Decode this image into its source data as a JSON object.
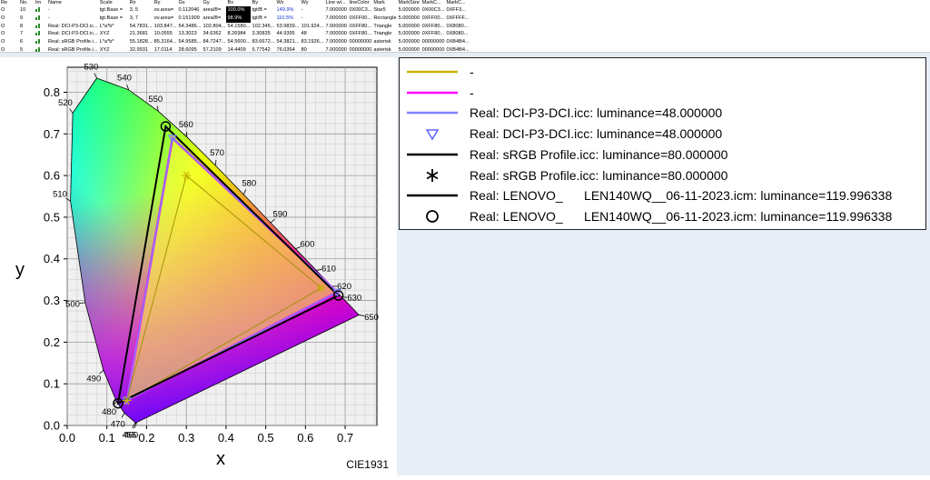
{
  "table": {
    "headers": [
      "Re",
      "No.",
      "Im",
      "Name",
      "Scale",
      "Rx",
      "Ry",
      "Gx",
      "Gy",
      "Bx",
      "By",
      "Wx",
      "Wy",
      "Line wi...",
      "lineColor",
      "Mark",
      "MarkSize",
      "MarkC...",
      "MarkC..."
    ],
    "rows": [
      [
        "O",
        "10",
        "",
        "-",
        "tgt.Base =",
        "3, 5",
        "ov.area=",
        "0.112046",
        "area/B=",
        "100.0%",
        "tgt/B =",
        "149.9%",
        "-",
        "7.000000",
        "0X00C3...",
        "Star5",
        "5.000000",
        "0X00C3...",
        "0XFF3..."
      ],
      [
        "O",
        "9",
        "",
        "-",
        "tgt.Base =",
        "3, 7",
        "ov.area=",
        "0.151909",
        "area/B=",
        "98.9%",
        "tgt/B =",
        "110.5%",
        "-",
        "7.000000",
        "0XFF00...",
        "Rectangle",
        "5.000000",
        "0XFF00...",
        "0XFFFF..."
      ],
      [
        "O",
        "8",
        "",
        "Real: DCI-P3-DCI.ic...",
        "L*a*b*",
        "54.7831...",
        "103.847...",
        "54.3486...",
        "102.804...",
        "54.1580...",
        "102.345...",
        "53.9839...",
        "101.924...",
        "7.000000",
        "0XFF80...",
        "Triangle",
        "5.000000",
        "0XFF80...",
        "0X8080..."
      ],
      [
        "O",
        "7",
        "",
        "Real: DCI-P3-DCI.ic...",
        "XYZ",
        "21.3681",
        "10.0555",
        "13.3023",
        "34.6362",
        "8.26984",
        "3.30835",
        "44.9395",
        "48",
        "7.000000",
        "0XFF80...",
        "Triangle",
        "5.000000",
        "0XFF80...",
        "0X8080..."
      ],
      [
        "O",
        "6",
        "",
        "Real: sRGB Profile.i...",
        "L*a*b*",
        "55.1828...",
        "85.3164...",
        "54.9585...",
        "84.7247...",
        "54.5600...",
        "83.6672...",
        "54.3821...",
        "83.1926...",
        "7.000000",
        "00000000",
        "asterisk",
        "5.000000",
        "00000000",
        "0XB4B4..."
      ],
      [
        "O",
        "5",
        "",
        "Real: sRGB Profile.i...",
        "XYZ",
        "32.9931",
        "17.0114",
        "28.6095",
        "57.2109",
        "14.4409",
        "5.77542",
        "76.0364",
        "80",
        "7.000000",
        "00000000",
        "asterisk",
        "5.000000",
        "00000000",
        "0XB4B4..."
      ]
    ],
    "highlighted_cells": [
      "100.0%",
      "98.9%"
    ],
    "blue_cells": [
      "149.9%",
      "110.5%"
    ]
  },
  "legend": {
    "entries": [
      {
        "label": "-",
        "symbol": "line",
        "color": "#c8b400"
      },
      {
        "label": "-",
        "symbol": "line",
        "color": "#ff00ff"
      },
      {
        "label": "Real: DCI-P3-DCI.icc: luminance=48.000000",
        "symbol": "line",
        "color": "#8080ff"
      },
      {
        "label": "Real: DCI-P3-DCI.icc: luminance=48.000000",
        "symbol": "triangle-down",
        "color": "#6060ff"
      },
      {
        "label": "Real: sRGB Profile.icc: luminance=80.000000",
        "symbol": "line",
        "color": "#000000"
      },
      {
        "label": "Real: sRGB Profile.icc: luminance=80.000000",
        "symbol": "asterisk",
        "color": "#000000"
      },
      {
        "label": "Real: LENOVO_      LEN140WQ__06-11-2023.icm: luminance=119.996338",
        "symbol": "line",
        "color": "#000000"
      },
      {
        "label": "Real: LENOVO_      LEN140WQ__06-11-2023.icm: luminance=119.996338",
        "symbol": "circle",
        "color": "#000000"
      }
    ]
  },
  "chart_data": {
    "type": "scatter",
    "title": "",
    "xlabel": "x",
    "ylabel": "y",
    "corner_label": "CIE1931",
    "xlim": [
      0.0,
      0.78
    ],
    "ylim": [
      0.0,
      0.86
    ],
    "x_ticks": [
      "0.0",
      "0.1",
      "0.2",
      "0.3",
      "0.4",
      "0.5",
      "0.6",
      "0.7"
    ],
    "y_ticks": [
      "0.0",
      "0.1",
      "0.2",
      "0.3",
      "0.4",
      "0.5",
      "0.6",
      "0.7",
      "0.8"
    ],
    "grid": true,
    "legend_position": "right",
    "spectral_locus": {
      "wavelength_labels": [
        "455",
        "460",
        "470",
        "480",
        "490",
        "500",
        "510",
        "520",
        "530",
        "540",
        "550",
        "560",
        "570",
        "580",
        "590",
        "600",
        "610",
        "620",
        "630",
        "650"
      ],
      "points": [
        [
          0.17,
          0.005
        ],
        [
          0.1741,
          0.005
        ],
        [
          0.144,
          0.0297
        ],
        [
          0.1241,
          0.0578
        ],
        [
          0.0913,
          0.1327
        ],
        [
          0.0454,
          0.295
        ],
        [
          0.0082,
          0.5384
        ],
        [
          0.0139,
          0.7502
        ],
        [
          0.0743,
          0.8338
        ],
        [
          0.1547,
          0.8059
        ],
        [
          0.2296,
          0.7543
        ],
        [
          0.3016,
          0.6923
        ],
        [
          0.3731,
          0.6245
        ],
        [
          0.4441,
          0.5547
        ],
        [
          0.5125,
          0.4866
        ],
        [
          0.5752,
          0.4242
        ],
        [
          0.627,
          0.3725
        ],
        [
          0.6658,
          0.334
        ],
        [
          0.6915,
          0.3083
        ],
        [
          0.7079,
          0.292
        ],
        [
          0.7347,
          0.2653
        ]
      ]
    },
    "series": [
      {
        "name": "-",
        "color": "#c8b400",
        "fill": "#ffff40",
        "points": [
          [
            0.68,
            0.32
          ],
          [
            0.265,
            0.69
          ],
          [
            0.15,
            0.06
          ]
        ]
      },
      {
        "name": "-",
        "color": "#ff00ff",
        "fill": "#ffff00",
        "points": [
          [
            0.68,
            0.32
          ],
          [
            0.265,
            0.69
          ],
          [
            0.15,
            0.06
          ]
        ]
      },
      {
        "name": "Real: DCI-P3-DCI.icc: luminance=48.000000",
        "color": "#8080ff",
        "marker": "triangle-down",
        "points": [
          [
            0.68,
            0.32
          ],
          [
            0.265,
            0.69
          ],
          [
            0.15,
            0.06
          ]
        ]
      },
      {
        "name": "Real: sRGB Profile.icc: luminance=80.000000",
        "color": "#000000",
        "marker": "asterisk",
        "points": [
          [
            0.64,
            0.33
          ],
          [
            0.3,
            0.6
          ],
          [
            0.15,
            0.06
          ]
        ]
      },
      {
        "name": "Real: LENOVO_      LEN140WQ__06-11-2023.icm: luminance=119.996338",
        "color": "#000000",
        "marker": "circle",
        "points": [
          [
            0.683,
            0.312
          ],
          [
            0.248,
            0.718
          ],
          [
            0.128,
            0.053
          ]
        ]
      }
    ]
  }
}
